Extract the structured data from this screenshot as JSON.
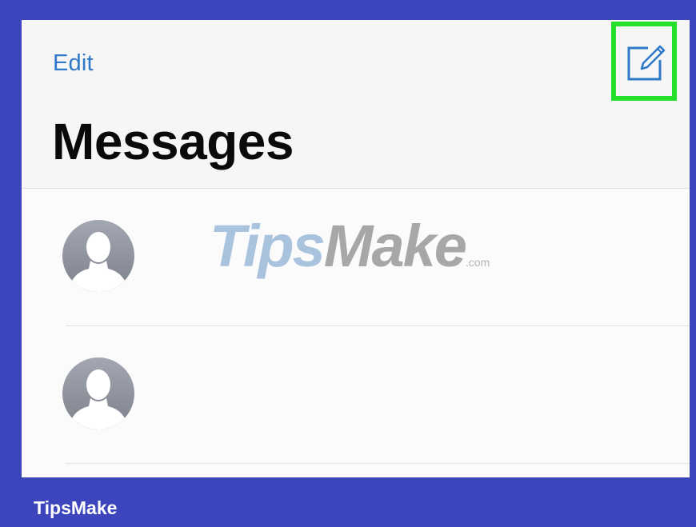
{
  "header": {
    "edit_label": "Edit",
    "title": "Messages",
    "compose_icon": "compose-icon"
  },
  "conversations": [
    {
      "avatar_icon": "person-silhouette-icon"
    },
    {
      "avatar_icon": "person-silhouette-icon"
    }
  ],
  "watermark": {
    "part1": "Tips",
    "part2": "Make",
    "suffix": ".com"
  },
  "footer": {
    "brand": "TipsMake"
  },
  "colors": {
    "frame_background": "#3d45bd",
    "link_blue": "#2f79c8",
    "highlight_green": "#25e02b",
    "title_black": "#0a0a0a",
    "avatar_gray": "#8e929e"
  }
}
